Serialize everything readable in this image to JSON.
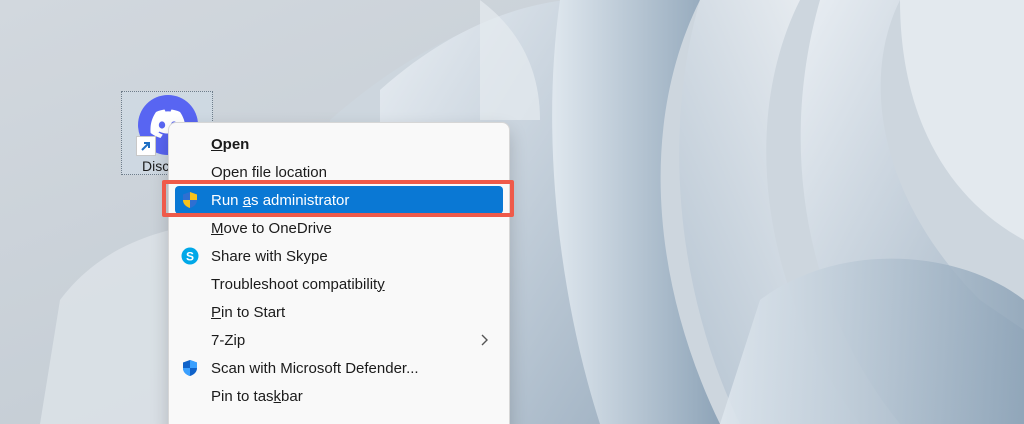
{
  "desktop_icon": {
    "label": "Discord"
  },
  "context_menu": {
    "items": [
      {
        "label": "Open",
        "accesskey": "O",
        "icon": "none"
      },
      {
        "label": "Open file location",
        "accesskey": "",
        "icon": "none"
      },
      {
        "label": "Run as administrator",
        "accesskey": "a",
        "icon": "uac-shield-icon",
        "highlighted": true
      },
      {
        "label": "Move to OneDrive",
        "accesskey": "M",
        "icon": "none"
      },
      {
        "label": "Share with Skype",
        "accesskey": "",
        "icon": "skype-icon"
      },
      {
        "label": "Troubleshoot compatibility",
        "accesskey": "y",
        "icon": "none"
      },
      {
        "label": "Pin to Start",
        "accesskey": "P",
        "icon": "none"
      },
      {
        "label": "7-Zip",
        "accesskey": "",
        "icon": "none",
        "submenu": true
      },
      {
        "label": "Scan with Microsoft Defender...",
        "accesskey": "",
        "icon": "defender-shield-icon"
      },
      {
        "label": "Pin to taskbar",
        "accesskey": "k",
        "icon": "none"
      }
    ]
  },
  "colors": {
    "highlight_row": "#0a78d4",
    "annotation_frame": "#ef5a4a",
    "discord_brand": "#5865f2"
  }
}
